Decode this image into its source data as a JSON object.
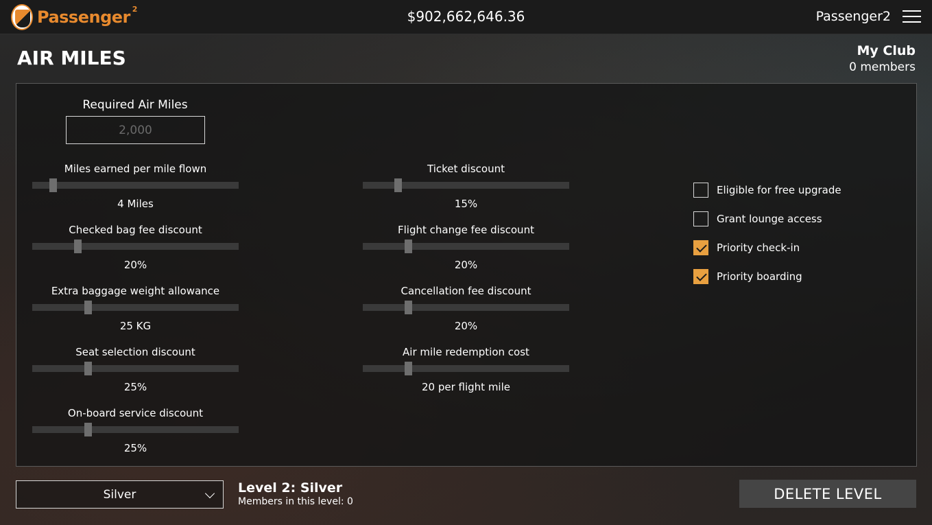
{
  "topbar": {
    "logo_text": "Passenger",
    "logo_sup": "2",
    "balance": "$902,662,646.36",
    "username": "Passenger2"
  },
  "header": {
    "title": "AIR MILES",
    "club_name": "My Club",
    "club_members": "0 members"
  },
  "required": {
    "label": "Required Air Miles",
    "placeholder": "2,000"
  },
  "sliders_left": [
    {
      "label": "Miles earned per mile flown",
      "value": "4 Miles",
      "level": 0.1
    },
    {
      "label": "Checked bag fee discount",
      "value": "20%",
      "level": 0.22
    },
    {
      "label": "Extra baggage weight allowance",
      "value": "25 KG",
      "level": 0.27
    },
    {
      "label": "Seat selection discount",
      "value": "25%",
      "level": 0.27
    },
    {
      "label": "On-board service discount",
      "value": "25%",
      "level": 0.27
    }
  ],
  "sliders_right": [
    {
      "label": "Ticket discount",
      "value": "15%",
      "level": 0.17
    },
    {
      "label": "Flight change fee discount",
      "value": "20%",
      "level": 0.22
    },
    {
      "label": "Cancellation fee discount",
      "value": "20%",
      "level": 0.22
    },
    {
      "label": "Air mile redemption cost",
      "value": "20 per flight mile",
      "level": 0.22
    }
  ],
  "checkboxes": [
    {
      "label": "Eligible for free upgrade",
      "checked": false
    },
    {
      "label": "Grant lounge access",
      "checked": false
    },
    {
      "label": "Priority check-in",
      "checked": true
    },
    {
      "label": "Priority boarding",
      "checked": true
    }
  ],
  "footer": {
    "selected_level": "Silver",
    "level_title": "Level 2: Silver",
    "level_members": "Members in this level: 0",
    "delete_label": "DELETE LEVEL"
  },
  "colors": {
    "accent": "#e88a2e",
    "checkbox_checked": "#e8a040"
  }
}
